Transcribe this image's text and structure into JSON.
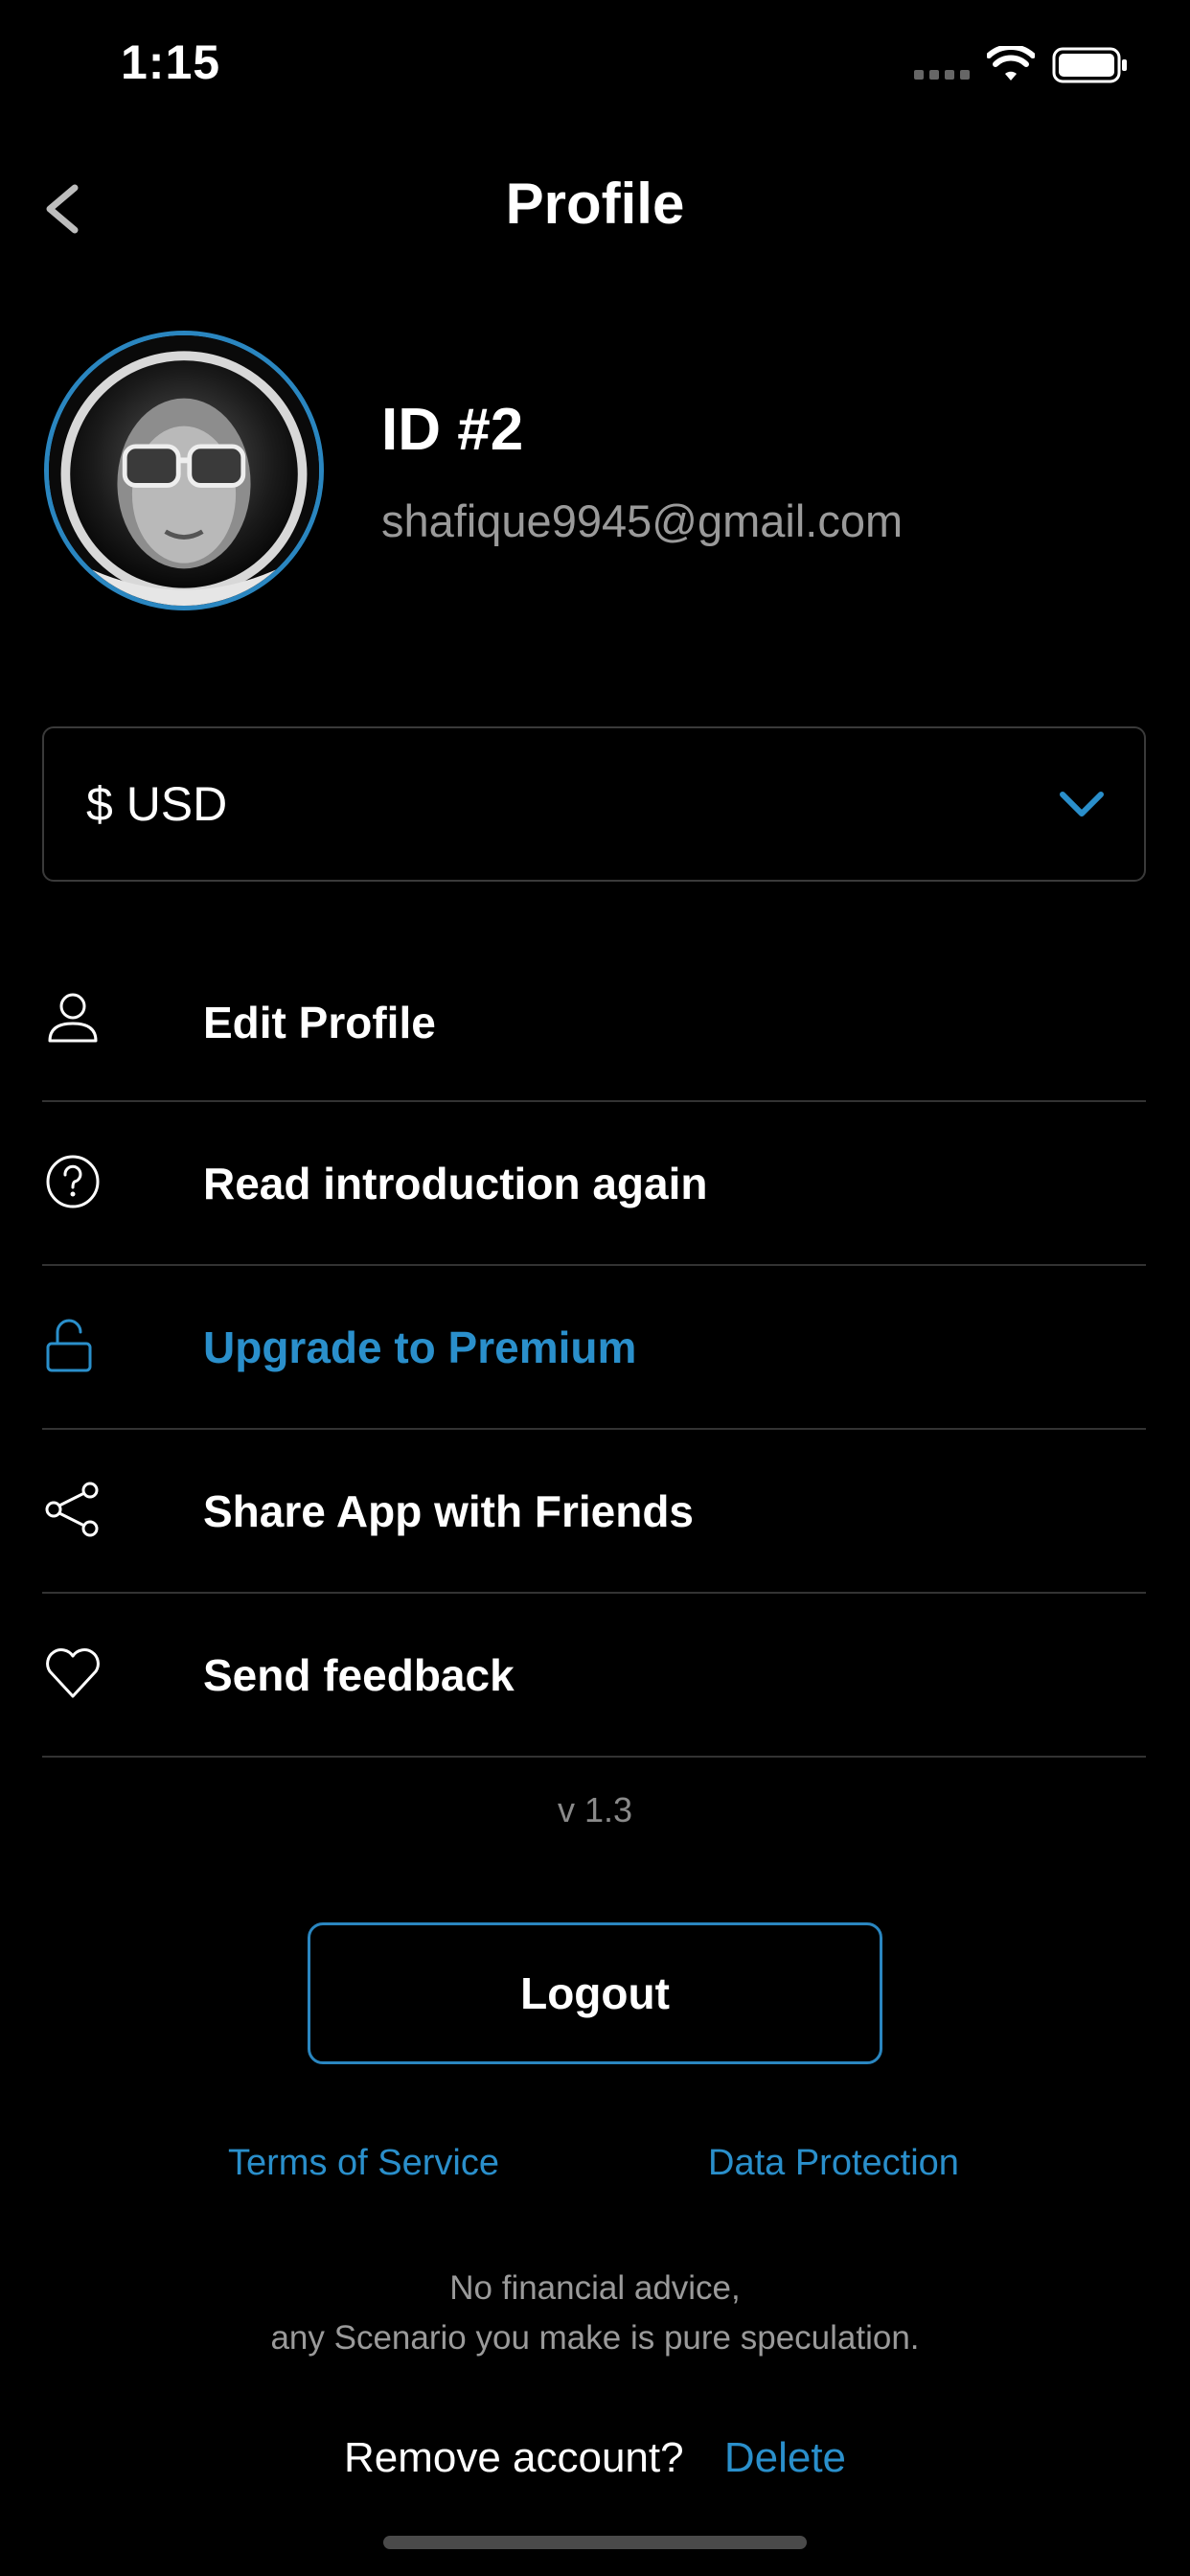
{
  "status_bar": {
    "time": "1:15"
  },
  "header": {
    "title": "Profile",
    "back_icon": "chevron-left-icon"
  },
  "profile": {
    "id_label": "ID #2",
    "email": "shafique9945@gmail.com",
    "avatar": "astronaut-avatar"
  },
  "currency": {
    "selected": "$ USD",
    "icon": "chevron-down-icon"
  },
  "menu": {
    "items": [
      {
        "label": "Edit Profile",
        "icon": "user-icon"
      },
      {
        "label": "Read introduction again",
        "icon": "question-circle-icon"
      },
      {
        "label": "Upgrade to Premium",
        "icon": "unlock-icon"
      },
      {
        "label": "Share App with Friends",
        "icon": "share-icon"
      },
      {
        "label": "Send feedback",
        "icon": "heart-icon"
      }
    ]
  },
  "version": "v 1.3",
  "actions": {
    "logout_label": "Logout"
  },
  "links": {
    "terms": "Terms of Service",
    "privacy": "Data Protection"
  },
  "disclaimer": {
    "line1": "No financial advice,",
    "line2": "any Scenario you make is pure speculation."
  },
  "remove_account": {
    "label": "Remove account?",
    "action": "Delete"
  },
  "colors": {
    "background": "#000000",
    "accent": "#2a8fcb",
    "muted": "#9a9a9a"
  }
}
